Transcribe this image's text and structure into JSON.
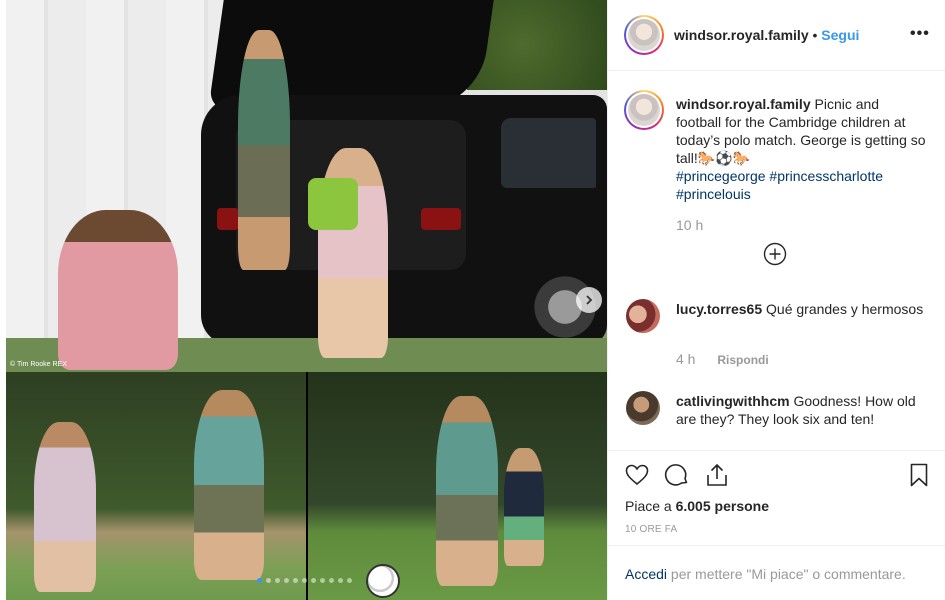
{
  "post": {
    "username": "windsor.royal.family",
    "separator": "•",
    "follow_label": "Segui",
    "more_label": "•••",
    "photo_credit": "© Tim Rooke REX",
    "carousel": {
      "count": 11,
      "active_index": 0
    }
  },
  "caption": {
    "username": "windsor.royal.family",
    "text": "Picnic and football for the Cambridge children at today’s polo match. George is getting so tall!🐎⚽🐎",
    "hashtags": [
      "#princegeorge",
      "#princesscharlotte",
      "#princelouis"
    ],
    "time": "10 h"
  },
  "comments": [
    {
      "username": "lucy.torres65",
      "text": "Qué grandes y hermosos",
      "time": "4 h",
      "reply_label": "Rispondi"
    },
    {
      "username": "catlivingwithhcm",
      "text": "Goodness! How old are they? They look six and ten!"
    }
  ],
  "actions": {
    "likes_prefix": "Piace a",
    "likes_count": "6.005",
    "likes_suffix": "persone",
    "timestamp": "10 ORE FA"
  },
  "login_prompt": {
    "link": "Accedi",
    "text": "per mettere \"Mi piace\" o commentare."
  },
  "icons": {
    "like": "heart-icon",
    "comment": "comment-icon",
    "share": "share-icon",
    "save": "bookmark-icon",
    "more": "more-icon",
    "next": "chevron-right-icon",
    "load": "plus-circle-icon"
  },
  "colors": {
    "link_blue": "#3897f0",
    "hashtag_blue": "#003569",
    "muted": "#999999",
    "text": "#262626"
  }
}
